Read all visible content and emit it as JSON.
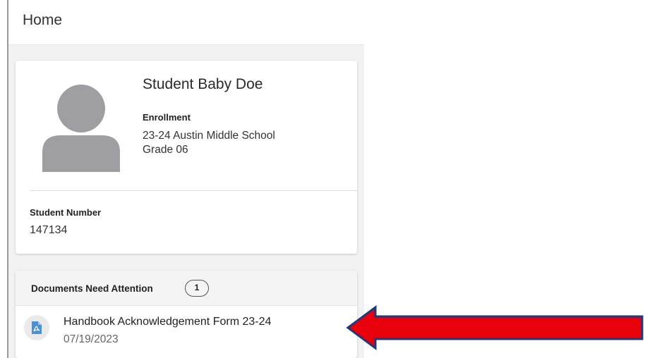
{
  "header": {
    "title": "Home"
  },
  "profile": {
    "avatar_icon": "person-silhouette-icon",
    "name": "Student Baby Doe",
    "enrollment_label": "Enrollment",
    "school": "23-24 Austin Middle School",
    "grade": "Grade 06",
    "student_number_label": "Student Number",
    "student_number": "147134"
  },
  "documents": {
    "title": "Documents Need Attention",
    "count": "1",
    "items": [
      {
        "icon": "pdf-document-icon",
        "name": "Handbook Acknowledgement Form 23-24",
        "date": "07/19/2023"
      }
    ]
  },
  "annotation": {
    "arrow_color": "#e8000b",
    "arrow_outline": "#1f3a7a"
  },
  "colors": {
    "background": "#f2f2f2",
    "card": "#ffffff",
    "avatar": "#9e9ea3",
    "pdf_icon": "#4a90d9"
  }
}
